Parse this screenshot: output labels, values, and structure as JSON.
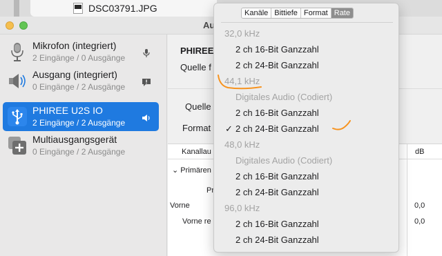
{
  "background_window": {
    "filename": "DSC03791.JPG"
  },
  "window": {
    "title": "Au"
  },
  "sidebar": {
    "devices": [
      {
        "name": "Mikrofon (integriert)",
        "sub": "2 Eingänge / 0 Ausgänge",
        "icon": "microphone-icon",
        "badge": "microphone-small-icon"
      },
      {
        "name": "Ausgang (integriert)",
        "sub": "0 Eingänge / 2 Ausgänge",
        "icon": "speaker-icon",
        "badge": "alert-bubble-icon"
      },
      {
        "name": "PHIREE U2S IO",
        "sub": "2 Eingänge / 2 Ausgänge",
        "icon": "usb-icon",
        "badge": "volume-icon",
        "selected": true
      },
      {
        "name": "Multiausgangsgerät",
        "sub": "0 Eingänge / 2 Ausgänge",
        "icon": "multi-output-icon"
      }
    ]
  },
  "content": {
    "device_title": "PHIREE",
    "clock_label": "Quelle f",
    "source_label": "Quelle",
    "format_label": "Format",
    "table": {
      "header_channel": "Kanallau",
      "header_db": "dB",
      "primary_label": "Primären",
      "rows": [
        {
          "label": "Pr",
          "value": ""
        },
        {
          "label": "Vorne",
          "value": "0,0"
        },
        {
          "label": "Vorne re",
          "value": "0,0"
        }
      ]
    }
  },
  "popup": {
    "tabs": [
      "Kanäle",
      "Bittiefe",
      "Format",
      "Rate"
    ],
    "active_tab": "Rate",
    "items": [
      {
        "kind": "header",
        "text": "32,0 kHz"
      },
      {
        "kind": "item",
        "text": "2 ch 16-Bit Ganzzahl"
      },
      {
        "kind": "item",
        "text": "2 ch 24-Bit Ganzzahl"
      },
      {
        "kind": "header",
        "text": "44,1 kHz"
      },
      {
        "kind": "subhdr",
        "text": "Digitales Audio (Codiert)"
      },
      {
        "kind": "item",
        "text": "2 ch 16-Bit Ganzzahl"
      },
      {
        "kind": "item",
        "text": "2 ch 24-Bit Ganzzahl",
        "checked": true
      },
      {
        "kind": "header",
        "text": "48,0 kHz"
      },
      {
        "kind": "subhdr",
        "text": "Digitales Audio (Codiert)"
      },
      {
        "kind": "item",
        "text": "2 ch 16-Bit Ganzzahl"
      },
      {
        "kind": "item",
        "text": "2 ch 24-Bit Ganzzahl"
      },
      {
        "kind": "header",
        "text": "96,0 kHz"
      },
      {
        "kind": "item",
        "text": "2 ch 16-Bit Ganzzahl"
      },
      {
        "kind": "item",
        "text": "2 ch 24-Bit Ganzzahl"
      }
    ],
    "check_mark": "✓"
  },
  "annotations": {
    "stroke_color": "#f7931e"
  }
}
